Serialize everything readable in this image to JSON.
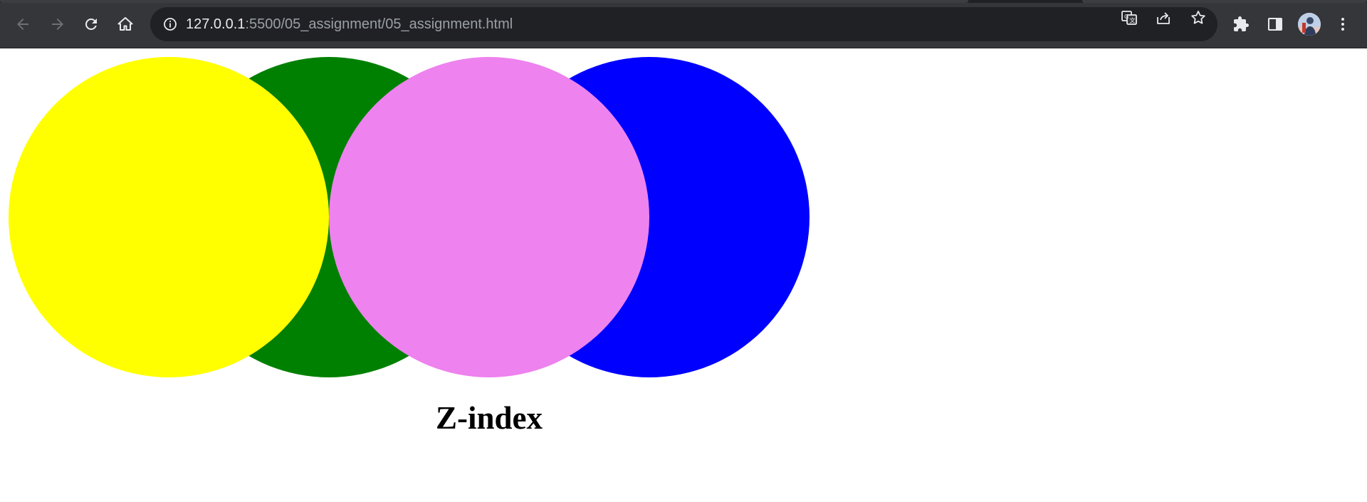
{
  "browser": {
    "url_host": "127.0.0.1",
    "url_rest": ":5500/05_assignment/05_assignment.html",
    "chrome_bg": "#35363a",
    "omnibox_bg": "#202124",
    "icons": {
      "back": "arrow-left-icon",
      "forward": "arrow-right-icon",
      "reload": "reload-icon",
      "home": "home-icon",
      "site_info": "info-icon",
      "translate": "translate-icon",
      "share": "share-icon",
      "bookmark": "star-icon",
      "extensions": "puzzle-icon",
      "side_panel": "side-panel-icon",
      "menu": "kebab-menu-icon"
    }
  },
  "page": {
    "heading": "Z-index",
    "circles": [
      {
        "name": "yellow",
        "color": "#ffff00"
      },
      {
        "name": "green",
        "color": "#008000"
      },
      {
        "name": "violet",
        "color": "#ee82ee"
      },
      {
        "name": "blue",
        "color": "#0000ff"
      }
    ]
  }
}
